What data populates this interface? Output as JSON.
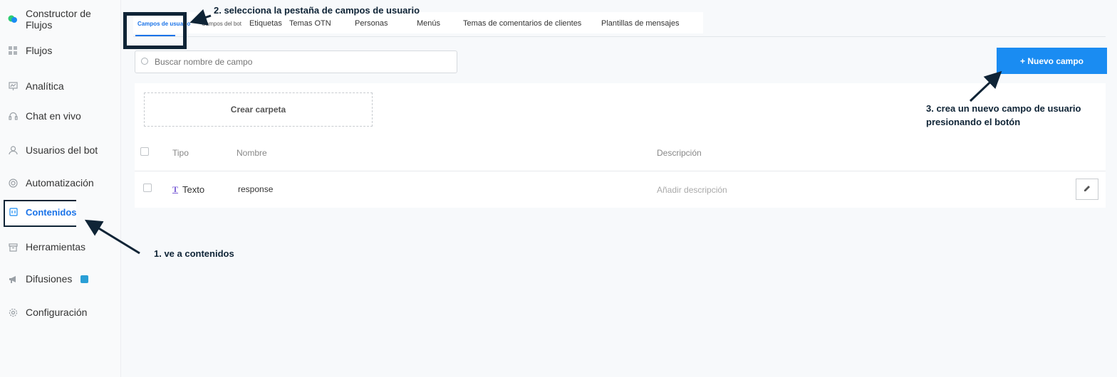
{
  "sidebar": {
    "items": [
      {
        "label": "Constructor de Flujos",
        "icon": "chat-bubbles-icon"
      },
      {
        "label": "Flujos",
        "icon": "grid-icon"
      },
      {
        "label": "Analítica",
        "icon": "analytics-icon"
      },
      {
        "label": "Chat en vivo",
        "icon": "headset-icon"
      },
      {
        "label": "Usuarios del bot",
        "icon": "user-icon"
      },
      {
        "label": "Automatización",
        "icon": "automation-icon"
      },
      {
        "label": "Contenidos",
        "icon": "contents-icon"
      },
      {
        "label": "Herramientas",
        "icon": "toolbox-icon"
      },
      {
        "label": "Difusiones",
        "icon": "megaphone-icon"
      },
      {
        "label": "Configuración",
        "icon": "gear-icon"
      }
    ],
    "active_index": 6
  },
  "tabs": [
    {
      "label": "Campos de usuario"
    },
    {
      "label": "Campos del bot"
    },
    {
      "label": "Etiquetas"
    },
    {
      "label": "Temas OTN"
    },
    {
      "label": "Personas"
    },
    {
      "label": "Menús"
    },
    {
      "label": "Temas de comentarios de clientes"
    },
    {
      "label": "Plantillas de mensajes"
    }
  ],
  "search": {
    "placeholder": "Buscar nombre de campo"
  },
  "new_field_button": "+ Nuevo campo",
  "create_folder_button": "Crear carpeta",
  "table": {
    "headers": {
      "type": "Tipo",
      "name": "Nombre",
      "description": "Descripción"
    },
    "rows": [
      {
        "type": "Texto",
        "name": "response",
        "description_placeholder": "Añadir descripción"
      }
    ]
  },
  "annotations": {
    "step1": "1. ve a contenidos",
    "step2": "2. selecciona la pestaña de campos de usuario",
    "step3_line1": "3. crea un nuevo campo de usuario",
    "step3_line2": "presionando el botón"
  },
  "colors": {
    "accent": "#1a8cf2",
    "annotation": "#0f2436"
  }
}
